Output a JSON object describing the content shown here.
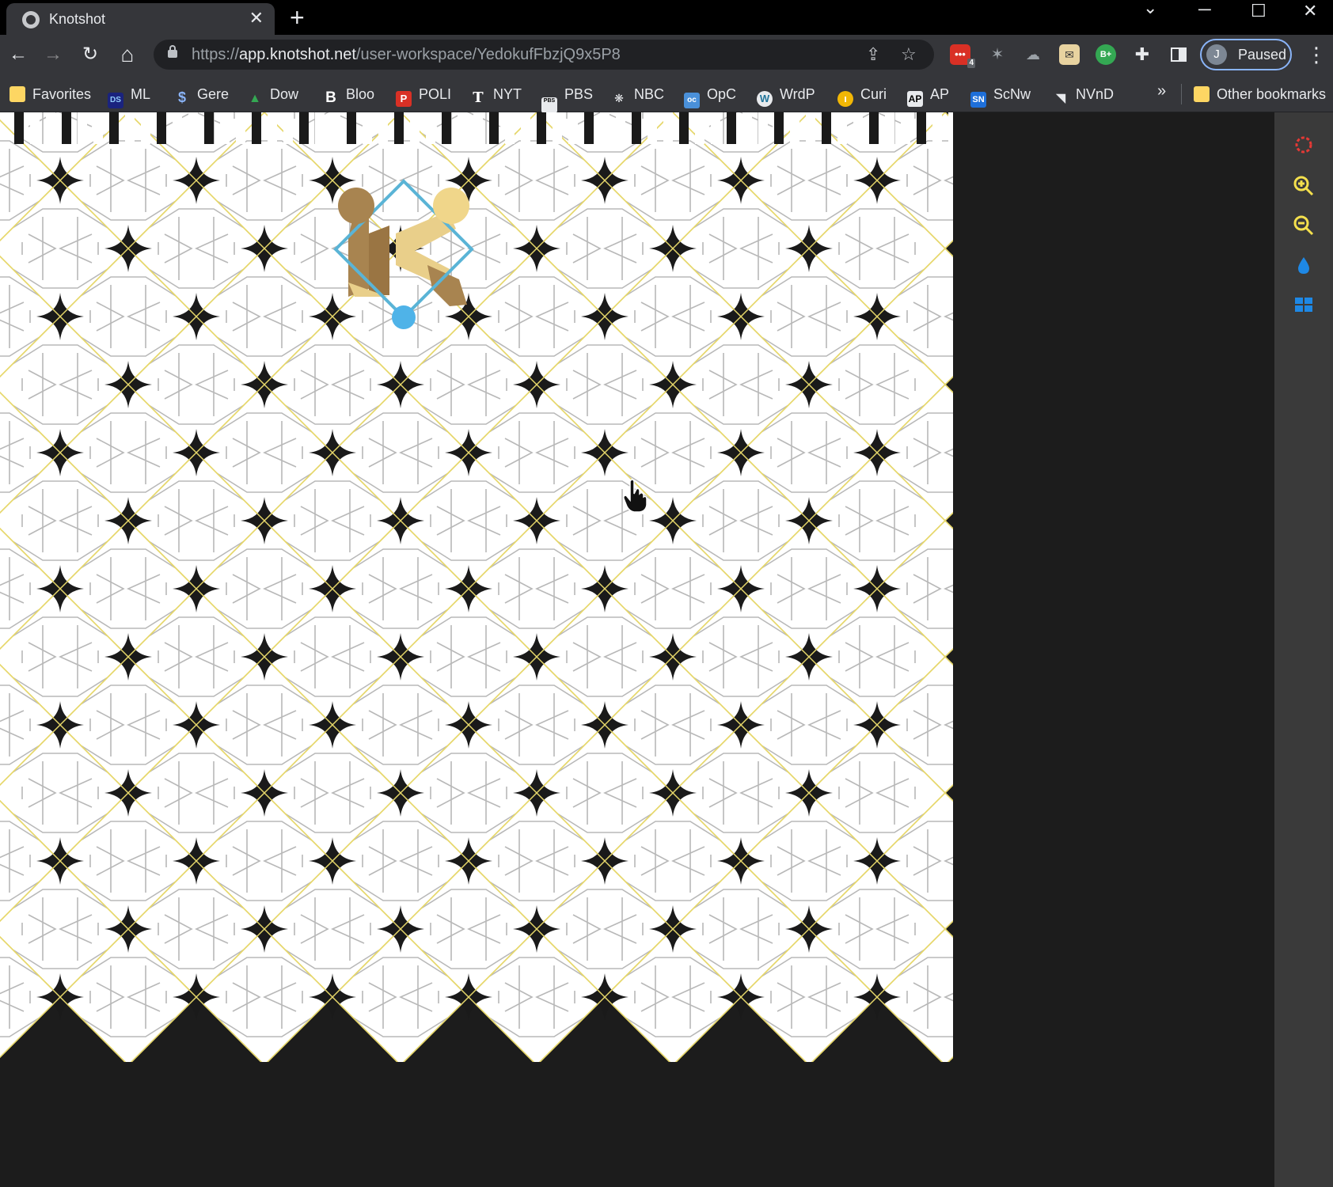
{
  "tab": {
    "title": "Knotshot",
    "close": "✕",
    "new_tab": "+"
  },
  "window_controls": {
    "dropdown": "⌄",
    "minimize": "─",
    "maximize": "☐",
    "close": "✕"
  },
  "toolbar": {
    "back": "←",
    "forward": "→",
    "reload": "↻",
    "home": "⌂",
    "url_prefix": "https://",
    "url_host": "app.knotshot.net",
    "url_path": "/user-workspace/YedokufFbzjQ9x5P8",
    "share": "⇪",
    "star": "☆",
    "ext_badge": "4",
    "ext_bplus": "B+",
    "profile_initial": "J",
    "profile_status": "Paused",
    "menu": "⋮"
  },
  "bookmarks": {
    "items": [
      {
        "label": "Favorites",
        "icon": "folder-icon"
      },
      {
        "label": "ML",
        "icon": "ml-icon"
      },
      {
        "label": "Gere",
        "icon": "s-icon"
      },
      {
        "label": "Dow",
        "icon": "dow-icon"
      },
      {
        "label": "Bloo",
        "icon": "b-icon"
      },
      {
        "label": "POLI",
        "icon": "p-icon"
      },
      {
        "label": "NYT",
        "icon": "nyt-icon"
      },
      {
        "label": "PBS",
        "icon": "pbs-icon"
      },
      {
        "label": "NBC",
        "icon": "nbc-icon"
      },
      {
        "label": "OpC",
        "icon": "oc-icon"
      },
      {
        "label": "WrdP",
        "icon": "wordpress-icon"
      },
      {
        "label": "Curi",
        "icon": "curi-icon"
      },
      {
        "label": "AP",
        "icon": "ap-icon"
      },
      {
        "label": "ScNw",
        "icon": "sn-icon"
      },
      {
        "label": "NVnD",
        "icon": "nvnd-icon"
      }
    ],
    "more": "»",
    "other": "Other bookmarks"
  },
  "sidebar_tools": [
    {
      "name": "gear-icon",
      "color": "#e53935"
    },
    {
      "name": "zoom-in-icon",
      "color": "#f4e04d"
    },
    {
      "name": "zoom-out-icon",
      "color": "#f4e04d"
    },
    {
      "name": "drop-icon",
      "color": "#1e88e5"
    },
    {
      "name": "grid-icon",
      "color": "#1e88e5"
    }
  ],
  "colors": {
    "tile_outline": "#e6d76a",
    "tile_fill": "#ffffff",
    "star": "#1a1a1a",
    "handle_blue": "#4fb3e8",
    "knot_gold": "#e9cf8a",
    "knot_dark": "#a88450"
  }
}
